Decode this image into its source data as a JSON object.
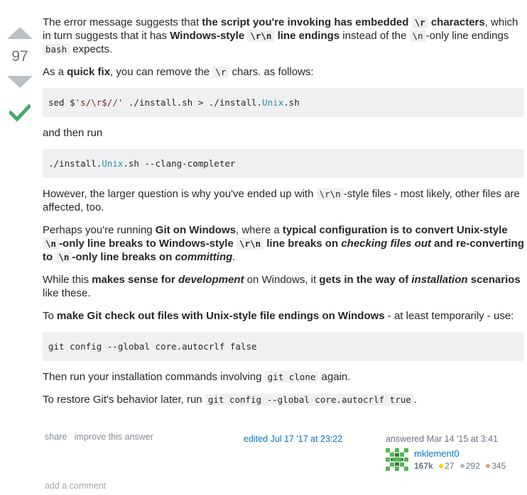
{
  "vote": {
    "count": "97",
    "accepted": true
  },
  "colors": {
    "accent": "#0077cc",
    "accepted": "#48a868",
    "vote_arrow": "#bbc0c4",
    "gold": "#ffcc01",
    "silver": "#b4b8bc",
    "bronze": "#d1a684"
  },
  "icons": {
    "up": "arrow-up-icon",
    "down": "arrow-down-icon",
    "check": "checkmark-icon"
  },
  "p1": {
    "t1": "The error message suggests that ",
    "b1": "the script you're invoking has embedded ",
    "c1": "\\r",
    "b2": " characters",
    "t2": ", which in turn suggests that it has ",
    "b3": "Windows-style ",
    "c2": "\\r\\n",
    "b4": " line endings",
    "t3": " instead of the ",
    "c3": "\\n",
    "t4": "-only line endings ",
    "c4": "bash",
    "t5": " expects."
  },
  "p2": {
    "t1": "As a ",
    "b1": "quick fix",
    "t2": ", you can remove the ",
    "c1": "\\r",
    "t3": " chars. as follows:"
  },
  "code1": {
    "a": "sed $",
    "b": "'s/\\r$//'",
    "c": " ./install.sh > ./install.",
    "d": "Unix",
    "e": ".sh"
  },
  "p3": "and then run",
  "code2": {
    "a": "./install.",
    "b": "Unix",
    "c": ".sh --clang-completer"
  },
  "p4": {
    "t1": "However, the larger question is why you've ended up with ",
    "c1": "\\r\\n",
    "t2": "-style files - most likely, other files are affected, too."
  },
  "p5": {
    "t1": "Perhaps you're running ",
    "b1": "Git on Windows",
    "t2": ", where a ",
    "b2": "typical configuration is to convert Unix-style ",
    "c1": "\\n",
    "b3": "-only line breaks to Windows-style ",
    "c2": "\\r\\n",
    "b4": " line breaks on ",
    "bi1": "checking files out",
    "b5": " and re-converting to ",
    "c3": "\\n",
    "b6": "-only line breaks on ",
    "bi2": "committing",
    "t3": "."
  },
  "p6": {
    "t1": "While this ",
    "b1": "makes sense for ",
    "bi1": "development",
    "t2": " on Windows, it ",
    "b2": "gets in the way of ",
    "bi2": "installation",
    "b3": " scenarios",
    "t3": " like these."
  },
  "p7": {
    "t1": "To ",
    "b1": "make Git check out files with Unix-style file endings on Windows",
    "t2": " - at least temporarily - use:"
  },
  "code3": "git config --global core.autocrlf false",
  "p8": {
    "t1": "Then run your installation commands involving ",
    "c1": "git clone",
    "t2": " again."
  },
  "p9": {
    "t1": "To restore Git's behavior later, run ",
    "c1": "git config --global core.autocrlf true",
    "t2": "."
  },
  "menu": {
    "share": "share",
    "improve": "improve this answer"
  },
  "edited": "edited Jul 17 '17 at 23:22",
  "answered": "answered Mar 14 '15 at 3:41",
  "user": {
    "name": "mklement0",
    "rep": "167k",
    "gold": "27",
    "silver": "292",
    "bronze": "345"
  },
  "add_comment": "add a comment"
}
